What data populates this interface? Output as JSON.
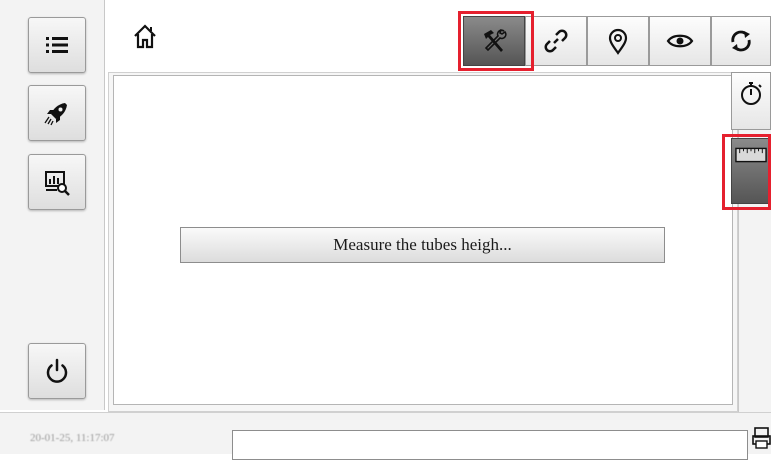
{
  "sidebar": {
    "items": [
      {
        "name": "menu",
        "icon": "list-icon"
      },
      {
        "name": "launch",
        "icon": "rocket-icon"
      },
      {
        "name": "analysis",
        "icon": "chart-search-icon"
      },
      {
        "name": "power",
        "icon": "power-icon"
      }
    ]
  },
  "topbar": {
    "home_icon": "home-icon",
    "tabs": [
      {
        "name": "tools",
        "icon": "hammer-wrench-icon",
        "active": true
      },
      {
        "name": "link",
        "icon": "link-icon",
        "active": false
      },
      {
        "name": "location",
        "icon": "map-pin-icon",
        "active": false
      },
      {
        "name": "view",
        "icon": "eye-icon",
        "active": false
      },
      {
        "name": "sync",
        "icon": "sync-icon",
        "active": false
      }
    ]
  },
  "main": {
    "action_button_label": "Measure the tubes heigh..."
  },
  "right_rail": {
    "items": [
      {
        "name": "timer",
        "icon": "stopwatch-icon",
        "active": false
      },
      {
        "name": "ruler",
        "icon": "ruler-icon",
        "active": true
      }
    ]
  },
  "status": {
    "timestamp": "20-01-25, 11:17:07",
    "message": "",
    "icon": "printer-icon"
  },
  "colors": {
    "highlight": "#e5202e",
    "active_tab": "#6a6a6a"
  }
}
